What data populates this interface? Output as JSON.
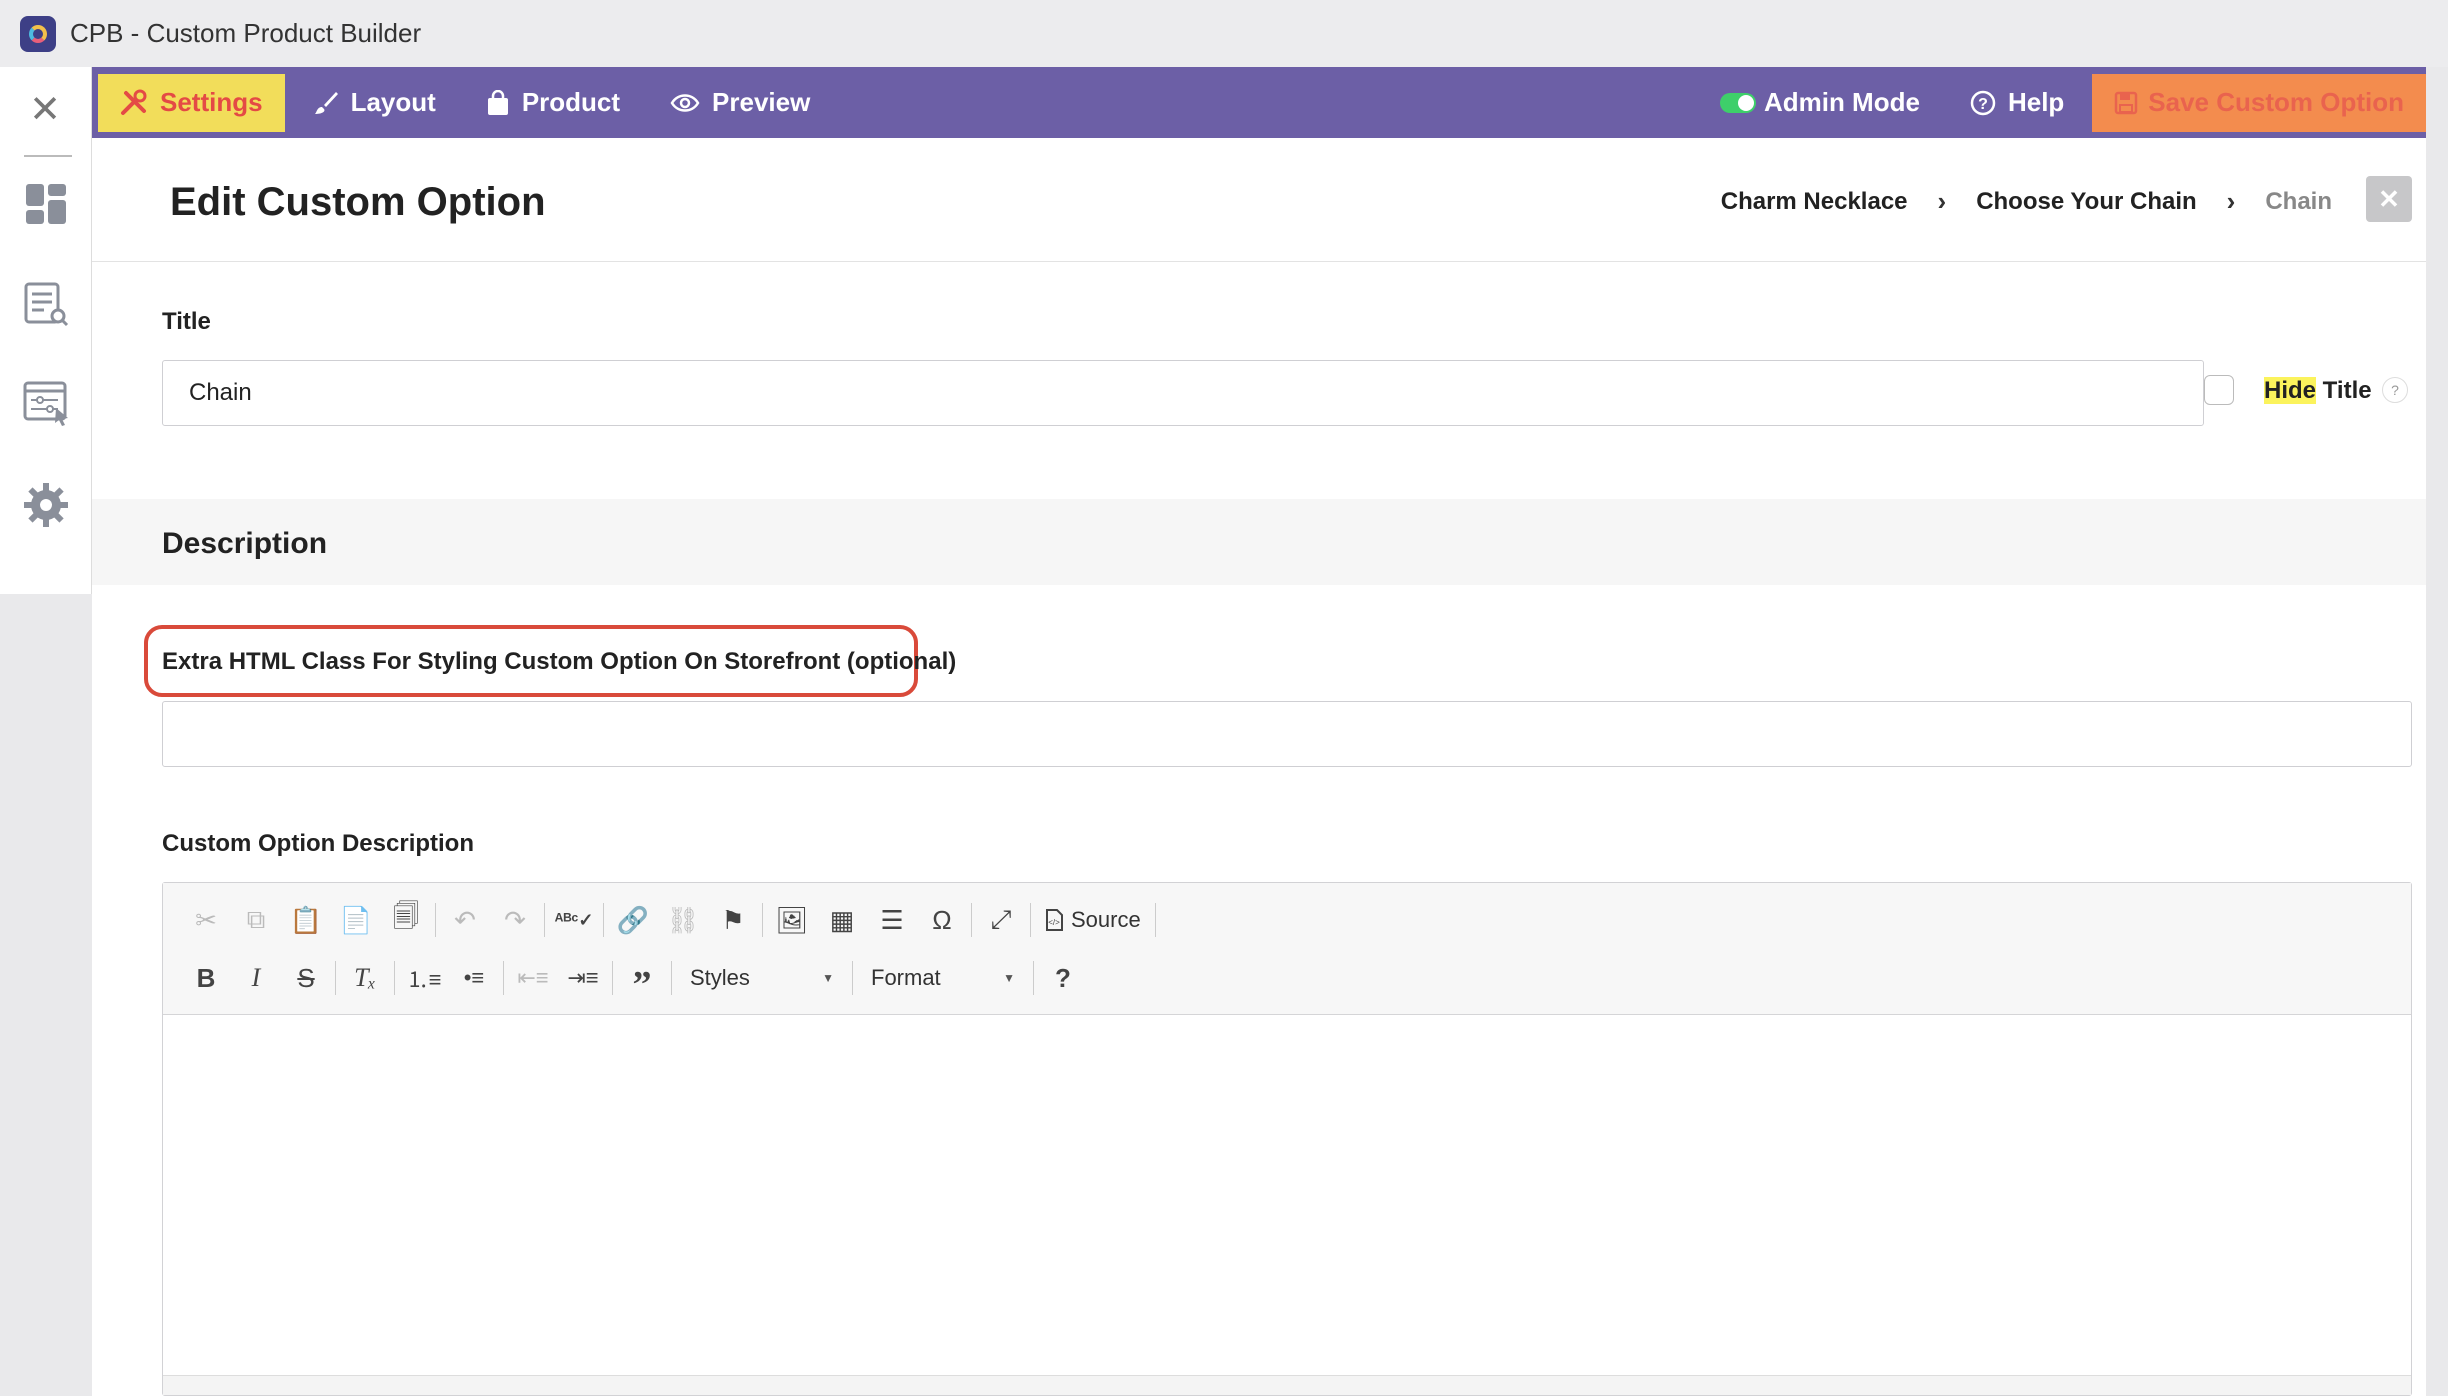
{
  "app": {
    "title": "CPB - Custom Product Builder"
  },
  "nav": {
    "settings": "Settings",
    "layout": "Layout",
    "product": "Product",
    "preview": "Preview",
    "admin_mode": "Admin Mode",
    "help": "Help",
    "save": "Save Custom Option"
  },
  "page": {
    "title": "Edit Custom Option",
    "breadcrumb": [
      "Charm Necklace",
      "Choose Your Chain",
      "Chain"
    ]
  },
  "form": {
    "title_label": "Title",
    "title_value": "Chain",
    "hide_title_hl": "Hide",
    "hide_title_rest": " Title",
    "help_mark": "?",
    "description_heading": "Description",
    "extra_class_label": "Extra HTML Class For Styling Custom Option On Storefront (optional)",
    "extra_class_value": "",
    "custom_desc_label": "Custom Option Description"
  },
  "editor": {
    "source_label": "Source",
    "styles_label": "Styles",
    "format_label": "Format",
    "help_mark": "?"
  },
  "colors": {
    "nav_bg": "#6c5fa6",
    "active_tab_bg": "#f2dd5a",
    "active_tab_text": "#e44a45",
    "save_bg": "#f38c4e",
    "highlight": "#d94a3a"
  }
}
